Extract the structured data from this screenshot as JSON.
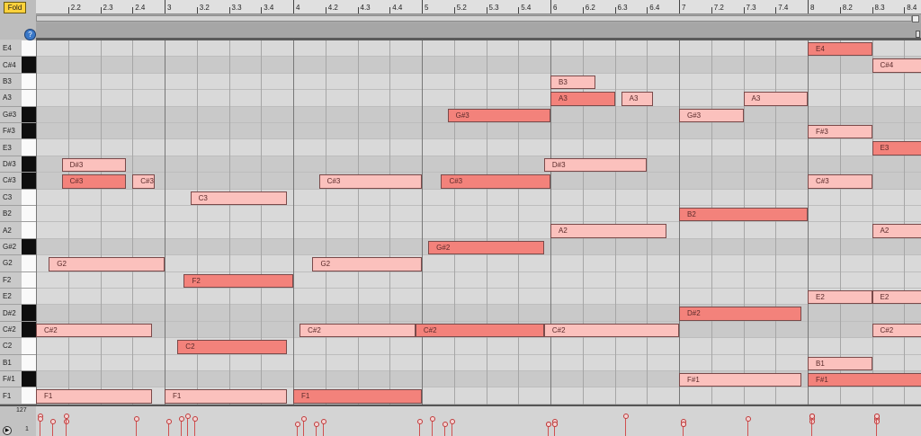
{
  "toolbar": {
    "fold_label": "Fold",
    "help_icon": "?"
  },
  "ruler": {
    "labels": [
      "2.2",
      "2.3",
      "2.4",
      "3",
      "3.2",
      "3.3",
      "3.4",
      "4",
      "4.2",
      "4.3",
      "4.4",
      "5",
      "5.2",
      "5.3",
      "5.4",
      "6",
      "6.2",
      "6.3",
      "6.4",
      "7",
      "7.2",
      "7.3",
      "7.4",
      "8",
      "8.2",
      "8.3",
      "8.4"
    ]
  },
  "keys": [
    "E4",
    "C#4",
    "B3",
    "A3",
    "G#3",
    "F#3",
    "E3",
    "D#3",
    "C#3",
    "C3",
    "B2",
    "A2",
    "G#2",
    "G2",
    "F2",
    "E2",
    "D#2",
    "C#2",
    "C2",
    "B1",
    "F#1",
    "F1"
  ],
  "notes": [
    {
      "pitch": "E4",
      "start": 8.0,
      "end": 8.5
    },
    {
      "pitch": "C#4",
      "start": 8.5,
      "end": 9.0
    },
    {
      "pitch": "B3",
      "start": 6.0,
      "end": 6.35
    },
    {
      "pitch": "A3",
      "start": 6.0,
      "end": 6.5
    },
    {
      "pitch": "A3",
      "start": 6.55,
      "end": 6.8
    },
    {
      "pitch": "A3",
      "start": 7.5,
      "end": 8.0
    },
    {
      "pitch": "G#3",
      "start": 5.2,
      "end": 6.0
    },
    {
      "pitch": "G#3",
      "start": 7.0,
      "end": 7.5
    },
    {
      "pitch": "F#3",
      "start": 8.0,
      "end": 8.5
    },
    {
      "pitch": "E3",
      "start": 8.5,
      "end": 9.0
    },
    {
      "pitch": "D#3",
      "start": 2.2,
      "end": 2.7
    },
    {
      "pitch": "D#3",
      "start": 5.95,
      "end": 6.75
    },
    {
      "pitch": "C#3",
      "start": 2.2,
      "end": 2.7
    },
    {
      "pitch": "C#3",
      "start": 2.75,
      "end": 2.92
    },
    {
      "pitch": "C#3",
      "start": 4.2,
      "end": 5.0
    },
    {
      "pitch": "C#3",
      "start": 5.15,
      "end": 6.0
    },
    {
      "pitch": "C#3",
      "start": 8.0,
      "end": 8.5
    },
    {
      "pitch": "C3",
      "start": 3.2,
      "end": 3.95
    },
    {
      "pitch": "B2",
      "start": 7.0,
      "end": 8.0
    },
    {
      "pitch": "A2",
      "start": 6.0,
      "end": 6.9
    },
    {
      "pitch": "A2",
      "start": 8.5,
      "end": 9.0
    },
    {
      "pitch": "G#2",
      "start": 5.05,
      "end": 5.95
    },
    {
      "pitch": "G2",
      "start": 2.1,
      "end": 3.0
    },
    {
      "pitch": "G2",
      "start": 4.15,
      "end": 5.0
    },
    {
      "pitch": "F2",
      "start": 3.15,
      "end": 4.0
    },
    {
      "pitch": "E2",
      "start": 8.0,
      "end": 8.5
    },
    {
      "pitch": "E2",
      "start": 8.5,
      "end": 9.0
    },
    {
      "pitch": "D#2",
      "start": 7.0,
      "end": 7.95
    },
    {
      "pitch": "C#2",
      "start": 2.0,
      "end": 2.9
    },
    {
      "pitch": "C#2",
      "start": 4.05,
      "end": 4.95
    },
    {
      "pitch": "C#2",
      "start": 4.95,
      "end": 5.95
    },
    {
      "pitch": "C#2",
      "start": 5.95,
      "end": 7.0
    },
    {
      "pitch": "C#2",
      "start": 8.5,
      "end": 9.0
    },
    {
      "pitch": "C2",
      "start": 3.1,
      "end": 3.95
    },
    {
      "pitch": "B1",
      "start": 8.0,
      "end": 8.5
    },
    {
      "pitch": "F#1",
      "start": 7.0,
      "end": 7.95
    },
    {
      "pitch": "F#1",
      "start": 8.0,
      "end": 9.0
    },
    {
      "pitch": "F1",
      "start": 2.0,
      "end": 2.9
    },
    {
      "pitch": "F1",
      "start": 3.0,
      "end": 3.95
    },
    {
      "pitch": "F1",
      "start": 4.0,
      "end": 5.0
    }
  ],
  "velocity": {
    "max_label": "127",
    "min_label": "1"
  },
  "colors": {
    "note_light": "#fbc1bd",
    "note_dark": "#f3827b"
  }
}
